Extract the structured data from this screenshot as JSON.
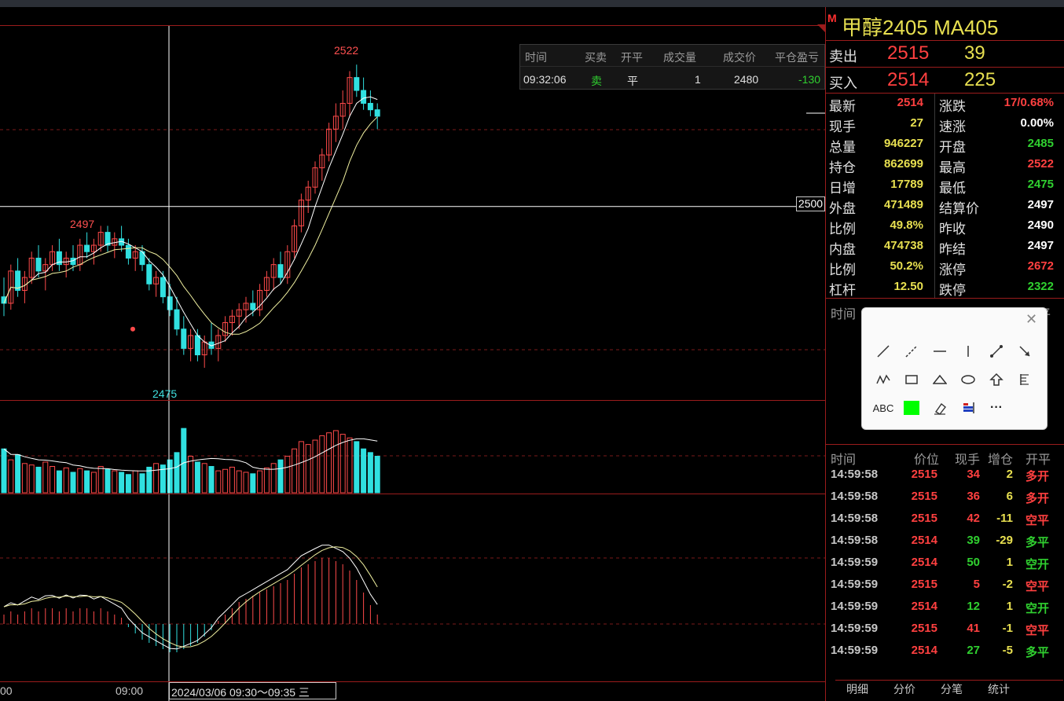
{
  "instrument": {
    "m_mark": "M",
    "title": "甲醇2405  MA405"
  },
  "orderbook": [
    {
      "label": "卖出",
      "price": "2515",
      "qty": "39"
    },
    {
      "label": "买入",
      "price": "2514",
      "qty": "225"
    }
  ],
  "stats": [
    {
      "k1": "最新",
      "v1": "2514",
      "c1": "#ff4040",
      "k2": "涨跌",
      "v2": "17/0.68%",
      "c2": "#ff4040"
    },
    {
      "k1": "现手",
      "v1": "27",
      "c1": "#e8e050",
      "k2": "速涨",
      "v2": "0.00%",
      "c2": "#ffffff"
    },
    {
      "k1": "总量",
      "v1": "946227",
      "c1": "#e8e050",
      "k2": "开盘",
      "v2": "2485",
      "c2": "#30d030"
    },
    {
      "k1": "持仓",
      "v1": "862699",
      "c1": "#e8e050",
      "k2": "最高",
      "v2": "2522",
      "c2": "#ff4040"
    },
    {
      "k1": "日增",
      "v1": "17789",
      "c1": "#e8e050",
      "k2": "最低",
      "v2": "2475",
      "c2": "#30d030"
    },
    {
      "k1": "外盘",
      "v1": "471489",
      "c1": "#e8e050",
      "k2": "结算价",
      "v2": "2497",
      "c2": "#ffffff"
    },
    {
      "k1": "比例",
      "v1": "49.8%",
      "c1": "#e8e050",
      "k2": "昨收",
      "v2": "2490",
      "c2": "#ffffff"
    },
    {
      "k1": "内盘",
      "v1": "474738",
      "c1": "#e8e050",
      "k2": "昨结",
      "v2": "2497",
      "c2": "#ffffff"
    },
    {
      "k1": "比例",
      "v1": "50.2%",
      "c1": "#e8e050",
      "k2": "涨停",
      "v2": "2672",
      "c2": "#ff4040"
    },
    {
      "k1": "杠杆",
      "v1": "12.50",
      "c1": "#e8e050",
      "k2": "跌停",
      "v2": "2322",
      "c2": "#30d030"
    }
  ],
  "ticks_header_top": {
    "time": "时间",
    "price": "价位",
    "qty": "现手",
    "oi": "增仓",
    "type": "开平"
  },
  "ticks_header": {
    "time": "时间",
    "price": "价位",
    "qty": "现手",
    "oi": "增仓",
    "type": "开平"
  },
  "ticks": [
    {
      "time": "14:59:58",
      "price": "2515",
      "qty": "34",
      "qc": "#ff4040",
      "oi": "2",
      "type": "多开",
      "tc": "#ff4040"
    },
    {
      "time": "14:59:58",
      "price": "2515",
      "qty": "36",
      "qc": "#ff4040",
      "oi": "6",
      "type": "多开",
      "tc": "#ff4040"
    },
    {
      "time": "14:59:58",
      "price": "2515",
      "qty": "42",
      "qc": "#ff4040",
      "oi": "-11",
      "type": "空平",
      "tc": "#ff4040"
    },
    {
      "time": "14:59:58",
      "price": "2514",
      "qty": "39",
      "qc": "#30d030",
      "oi": "-29",
      "type": "多平",
      "tc": "#30d030"
    },
    {
      "time": "14:59:59",
      "price": "2514",
      "qty": "50",
      "qc": "#30d030",
      "oi": "1",
      "type": "空开",
      "tc": "#30d030"
    },
    {
      "time": "14:59:59",
      "price": "2515",
      "qty": "5",
      "qc": "#ff4040",
      "oi": "-2",
      "type": "空平",
      "tc": "#ff4040"
    },
    {
      "time": "14:59:59",
      "price": "2514",
      "qty": "12",
      "qc": "#30d030",
      "oi": "1",
      "type": "空开",
      "tc": "#30d030"
    },
    {
      "time": "14:59:59",
      "price": "2515",
      "qty": "41",
      "qc": "#ff4040",
      "oi": "-1",
      "type": "空平",
      "tc": "#ff4040"
    },
    {
      "time": "14:59:59",
      "price": "2514",
      "qty": "27",
      "qc": "#30d030",
      "oi": "-5",
      "type": "多平",
      "tc": "#30d030"
    }
  ],
  "tabs": [
    "明细",
    "分价",
    "分笔",
    "统计"
  ],
  "trade_popup": {
    "headers": [
      "时间",
      "买卖",
      "开平",
      "成交量",
      "成交价",
      "平仓盈亏"
    ],
    "row": [
      "09:32:06",
      "卖",
      "平",
      "1",
      "2480",
      "-130"
    ]
  },
  "chart_labels": {
    "high": "2522",
    "left_high": "2497",
    "low": "2475",
    "price_tag": "2500"
  },
  "time_axis": {
    "left": "00",
    "mid": "09:00",
    "cursor": "2024/03/06 09:30～09:35 三"
  },
  "tools": {
    "abc": "ABC",
    "items": [
      "line-tool",
      "dashed-line-tool",
      "horizontal-line-tool",
      "vertical-line-tool",
      "segment-tool",
      "arrow-line-tool",
      "zigzag-tool",
      "rectangle-tool",
      "triangle-tool",
      "ellipse-tool",
      "up-arrow-tool",
      "fibonacci-tool",
      "text-tool",
      "color-tool",
      "eraser-tool",
      "flag-tool",
      "more-tool"
    ],
    "more": "···",
    "close": "✕"
  },
  "chart_data": {
    "type": "candlestick",
    "candles": [
      [
        2486,
        2489,
        2483,
        2485
      ],
      [
        2485,
        2491,
        2484,
        2490
      ],
      [
        2490,
        2492,
        2486,
        2487
      ],
      [
        2487,
        2490,
        2485,
        2489
      ],
      [
        2489,
        2493,
        2488,
        2492
      ],
      [
        2492,
        2494,
        2489,
        2490
      ],
      [
        2490,
        2492,
        2487,
        2491
      ],
      [
        2491,
        2494,
        2490,
        2493
      ],
      [
        2493,
        2495,
        2490,
        2491
      ],
      [
        2491,
        2493,
        2489,
        2492
      ],
      [
        2492,
        2494,
        2490,
        2491
      ],
      [
        2491,
        2495,
        2490,
        2494
      ],
      [
        2494,
        2496,
        2492,
        2493
      ],
      [
        2493,
        2495,
        2491,
        2494
      ],
      [
        2494,
        2497,
        2493,
        2496
      ],
      [
        2496,
        2497,
        2493,
        2494
      ],
      [
        2494,
        2496,
        2492,
        2495
      ],
      [
        2495,
        2497,
        2493,
        2494
      ],
      [
        2494,
        2495,
        2491,
        2492
      ],
      [
        2492,
        2494,
        2490,
        2493
      ],
      [
        2493,
        2494,
        2490,
        2491
      ],
      [
        2491,
        2492,
        2487,
        2488
      ],
      [
        2488,
        2490,
        2486,
        2489
      ],
      [
        2489,
        2490,
        2485,
        2486
      ],
      [
        2486,
        2488,
        2483,
        2484
      ],
      [
        2484,
        2486,
        2480,
        2481
      ],
      [
        2481,
        2483,
        2477,
        2478
      ],
      [
        2478,
        2481,
        2476,
        2480
      ],
      [
        2480,
        2481,
        2476,
        2477
      ],
      [
        2477,
        2480,
        2475,
        2479
      ],
      [
        2479,
        2482,
        2477,
        2478
      ],
      [
        2478,
        2481,
        2476,
        2480
      ],
      [
        2480,
        2483,
        2479,
        2482
      ],
      [
        2482,
        2484,
        2480,
        2483
      ],
      [
        2483,
        2485,
        2481,
        2484
      ],
      [
        2484,
        2486,
        2482,
        2485
      ],
      [
        2485,
        2487,
        2483,
        2484
      ],
      [
        2484,
        2488,
        2483,
        2487
      ],
      [
        2487,
        2490,
        2486,
        2489
      ],
      [
        2489,
        2492,
        2487,
        2491
      ],
      [
        2491,
        2493,
        2488,
        2489
      ],
      [
        2489,
        2494,
        2488,
        2493
      ],
      [
        2493,
        2498,
        2492,
        2497
      ],
      [
        2497,
        2502,
        2496,
        2501
      ],
      [
        2501,
        2504,
        2499,
        2503
      ],
      [
        2503,
        2507,
        2502,
        2506
      ],
      [
        2506,
        2509,
        2504,
        2508
      ],
      [
        2508,
        2513,
        2507,
        2512
      ],
      [
        2512,
        2516,
        2510,
        2514
      ],
      [
        2514,
        2518,
        2512,
        2516
      ],
      [
        2516,
        2521,
        2514,
        2520
      ],
      [
        2520,
        2522,
        2517,
        2518
      ],
      [
        2518,
        2520,
        2515,
        2516
      ],
      [
        2516,
        2518,
        2514,
        2515
      ],
      [
        2515,
        2516,
        2512,
        2514
      ]
    ],
    "volume": [
      60,
      45,
      52,
      40,
      38,
      35,
      42,
      36,
      30,
      34,
      28,
      33,
      30,
      28,
      36,
      32,
      30,
      28,
      25,
      30,
      26,
      35,
      40,
      38,
      45,
      55,
      88,
      50,
      42,
      40,
      36,
      30,
      32,
      35,
      30,
      28,
      26,
      30,
      34,
      40,
      45,
      50,
      60,
      70,
      66,
      72,
      78,
      82,
      85,
      80,
      75,
      70,
      60,
      55,
      50
    ],
    "macd": [
      3,
      4,
      3,
      4,
      5,
      4,
      5,
      5,
      4,
      5,
      4,
      5,
      5,
      4,
      5,
      4,
      3,
      2,
      -1,
      -3,
      -5,
      -6,
      -7,
      -8,
      -9,
      -9,
      -8,
      -7,
      -6,
      -4,
      -2,
      1,
      3,
      5,
      7,
      8,
      9,
      10,
      11,
      12,
      13,
      14,
      16,
      18,
      19,
      20,
      21,
      21,
      20,
      19,
      17,
      14,
      10,
      6,
      3
    ],
    "price_range": [
      2470,
      2528
    ],
    "levels": {
      "high": 2522,
      "low": 2475,
      "cursor": 2500
    }
  }
}
